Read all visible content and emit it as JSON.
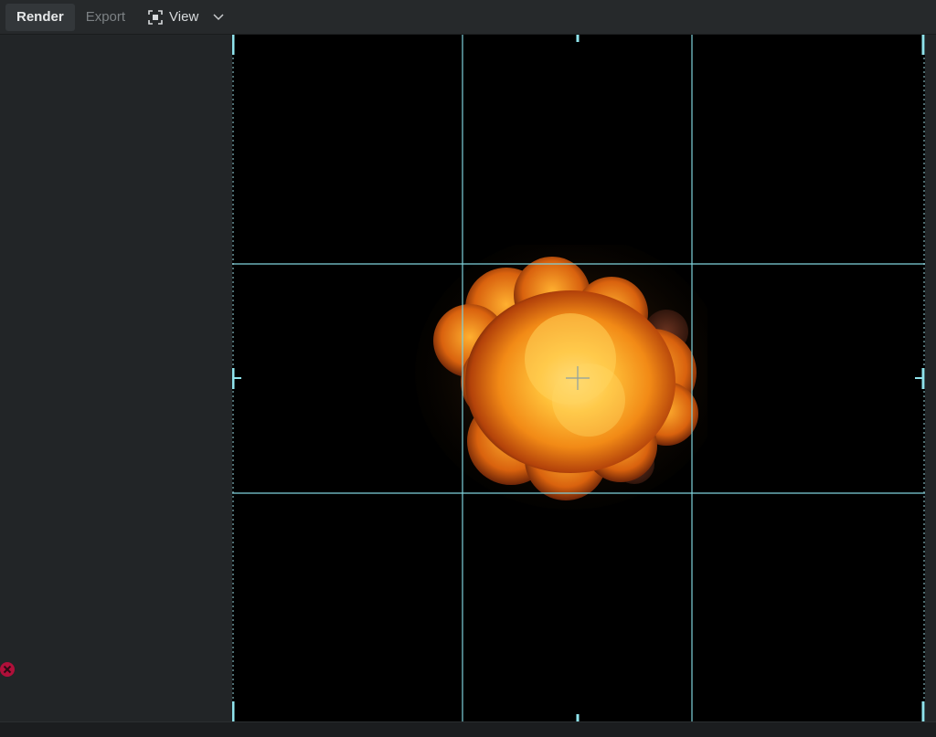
{
  "toolbar": {
    "tabs": [
      {
        "label": "Render",
        "active": true
      },
      {
        "label": "Export",
        "active": false
      }
    ],
    "view_label": "View",
    "view_icon": "focus-frame-icon",
    "dropdown_icon": "chevron-down-icon"
  },
  "left_panel": {
    "status_icon": "error-icon",
    "status_color": "#b0103a"
  },
  "viewport": {
    "content": "explosion-render",
    "guides": "rule-of-thirds",
    "guide_color": "#7fd3dc",
    "center_marker": "crosshair-icon"
  }
}
